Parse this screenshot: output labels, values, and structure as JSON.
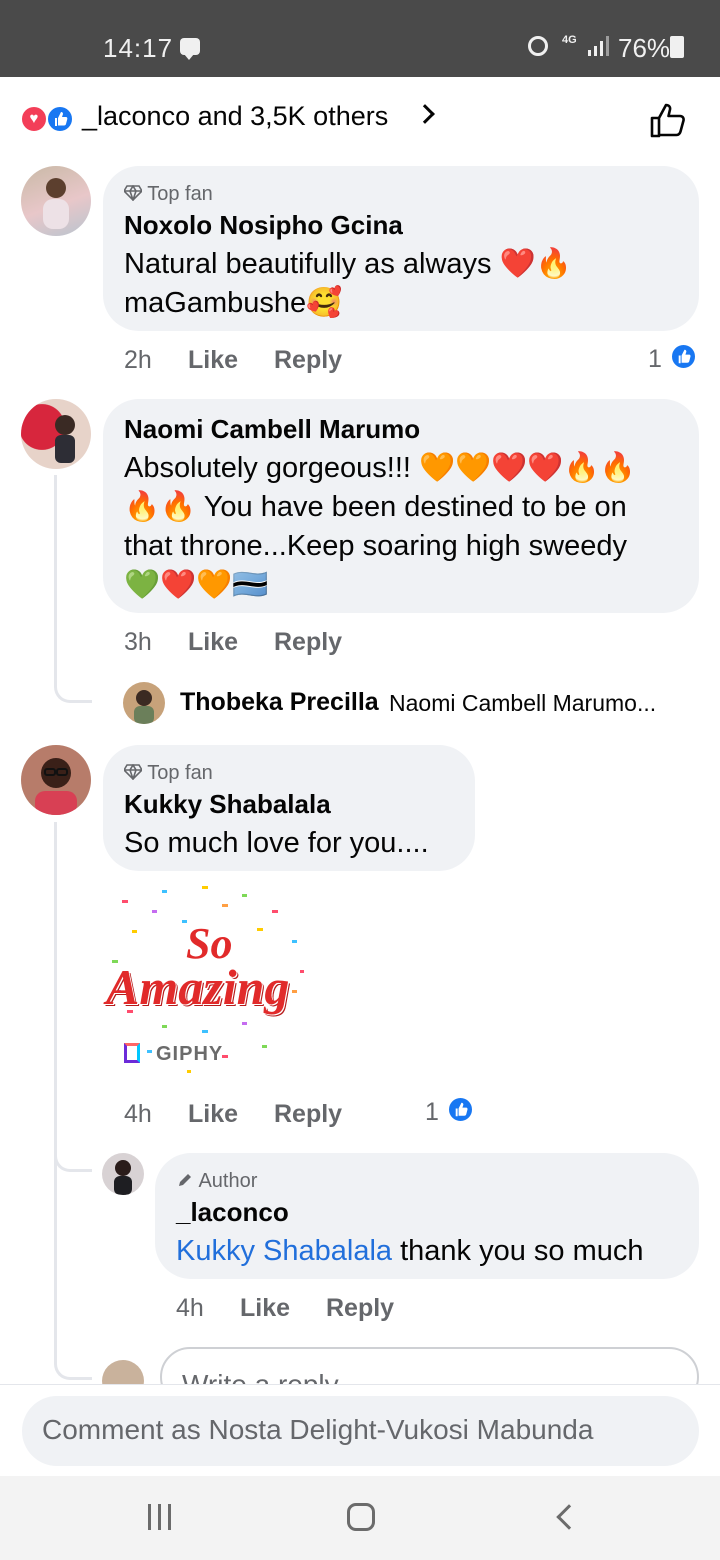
{
  "status_bar": {
    "time": "14:17",
    "network": "4G",
    "battery": "76%"
  },
  "reactions": {
    "summary": "_laconco and 3,5K others"
  },
  "comments": [
    {
      "badge": "Top fan",
      "author": "Noxolo Nosipho Gcina",
      "text_line1": "Natural beautifully as always ❤️🔥",
      "text_line2": "maGambushe🥰",
      "time": "2h",
      "like_label": "Like",
      "reply_label": "Reply",
      "like_count": "1"
    },
    {
      "author": "Naomi Cambell Marumo",
      "text_line1": "Absolutely gorgeous!!! 🧡🧡❤️❤️🔥🔥",
      "text_line2": "🔥🔥 You  have been destined  to be on",
      "text_line3": "that throne...Keep soaring high sweedy",
      "text_line4": "💚❤️🧡🇧🇼",
      "time": "3h",
      "like_label": "Like",
      "reply_label": "Reply",
      "reply_preview": {
        "author": "Thobeka Precilla",
        "text": "Naomi Cambell Marumo..."
      }
    },
    {
      "badge": "Top fan",
      "author": "Kukky Shabalala",
      "text": "So much love for you....",
      "gif": {
        "line1": "So",
        "line2": "Amazing",
        "source": "GIPHY"
      },
      "time": "4h",
      "like_label": "Like",
      "reply_label": "Reply",
      "like_count": "1",
      "reply": {
        "badge": "Author",
        "author": "_laconco",
        "mention": "Kukky Shabalala",
        "text": " thank you so much",
        "time": "4h",
        "like_label": "Like",
        "reply_label": "Reply"
      },
      "write_reply_placeholder": "Write a reply..."
    }
  ],
  "comment_box": {
    "placeholder": "Comment as Nosta Delight-Vukosi Mabunda"
  },
  "colors": {
    "accent": "#1877f2",
    "love": "#f33e58",
    "bubble": "#f0f2f5",
    "meta": "#65676b",
    "mention": "#216fdb"
  }
}
